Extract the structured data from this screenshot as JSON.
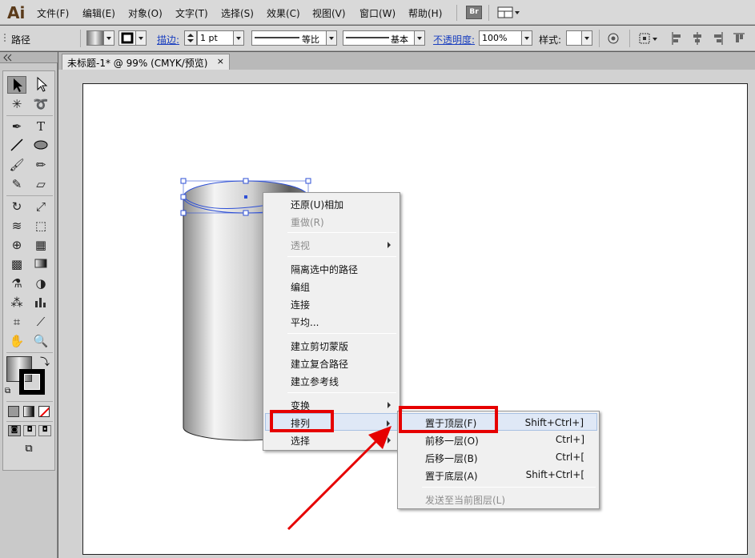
{
  "app": {
    "logo": "Ai"
  },
  "menubar": {
    "items": [
      "文件(F)",
      "编辑(E)",
      "对象(O)",
      "文字(T)",
      "选择(S)",
      "效果(C)",
      "视图(V)",
      "窗口(W)",
      "帮助(H)"
    ],
    "bridge_label": "Br"
  },
  "controlbar": {
    "selection_type": "路径",
    "stroke_label": "描边:",
    "stroke_weight": "1 pt",
    "profile_label": "等比",
    "brush_label": "基本",
    "opacity_label": "不透明度:",
    "opacity_value": "100%",
    "style_label": "样式:"
  },
  "document": {
    "tab_title": "未标题-1* @ 99% (CMYK/预览)",
    "close_glyph": "×"
  },
  "context_menu": {
    "items": [
      {
        "label": "还原(U)相加"
      },
      {
        "label": "重做(R)",
        "disabled": true
      },
      {
        "label": "透视",
        "disabled": true,
        "submenu": true
      },
      {
        "label": "隔离选中的路径"
      },
      {
        "label": "编组"
      },
      {
        "label": "连接"
      },
      {
        "label": "平均..."
      },
      {
        "label": "建立剪切蒙版"
      },
      {
        "label": "建立复合路径"
      },
      {
        "label": "建立参考线"
      },
      {
        "label": "变换",
        "submenu": true
      },
      {
        "label": "排列",
        "submenu": true,
        "hover": true
      },
      {
        "label": "选择",
        "submenu": true
      }
    ]
  },
  "arrange_submenu": {
    "items": [
      {
        "label": "置于顶层(F)",
        "shortcut": "Shift+Ctrl+]",
        "hover": true
      },
      {
        "label": "前移一层(O)",
        "shortcut": "Ctrl+]"
      },
      {
        "label": "后移一层(B)",
        "shortcut": "Ctrl+["
      },
      {
        "label": "置于底层(A)",
        "shortcut": "Shift+Ctrl+["
      },
      {
        "label": "发送至当前图层(L)",
        "disabled": true
      }
    ]
  },
  "colors": {
    "highlight": "#e60000",
    "menu_hover": "#dfe8f6",
    "link": "#1a3fbf"
  }
}
